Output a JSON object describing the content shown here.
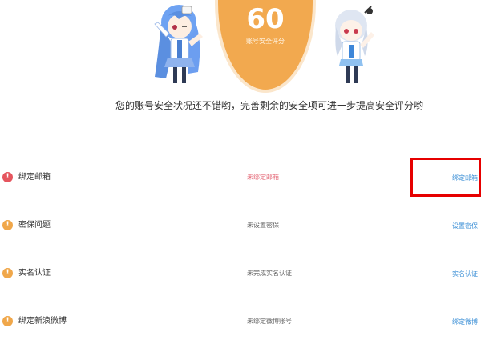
{
  "score": {
    "value": "60",
    "label": "账号安全评分",
    "color": "#f2a94f"
  },
  "tagline": "您的账号安全状况还不错哟，完善剩余的安全项可进一步提高安全评分哟",
  "items": [
    {
      "title": "绑定邮箱",
      "status": "未绑定邮箱",
      "action": "绑定邮箱",
      "icon": "alert-red-icon",
      "status_color": "#e56b7a"
    },
    {
      "title": "密保问题",
      "status": "未设置密保",
      "action": "设置密保",
      "icon": "alert-orange-icon",
      "status_color": "#666666"
    },
    {
      "title": "实名认证",
      "status": "未完成实名认证",
      "action": "实名认证",
      "icon": "alert-orange-icon",
      "status_color": "#666666"
    },
    {
      "title": "绑定新浪微博",
      "status": "未绑定微博账号",
      "action": "绑定微博",
      "icon": "alert-orange-icon",
      "status_color": "#666666"
    }
  ],
  "colors": {
    "alert_red": "#e5555e",
    "alert_orange": "#f0a74a",
    "link": "#3b8fd6",
    "highlight": "#e60000"
  }
}
